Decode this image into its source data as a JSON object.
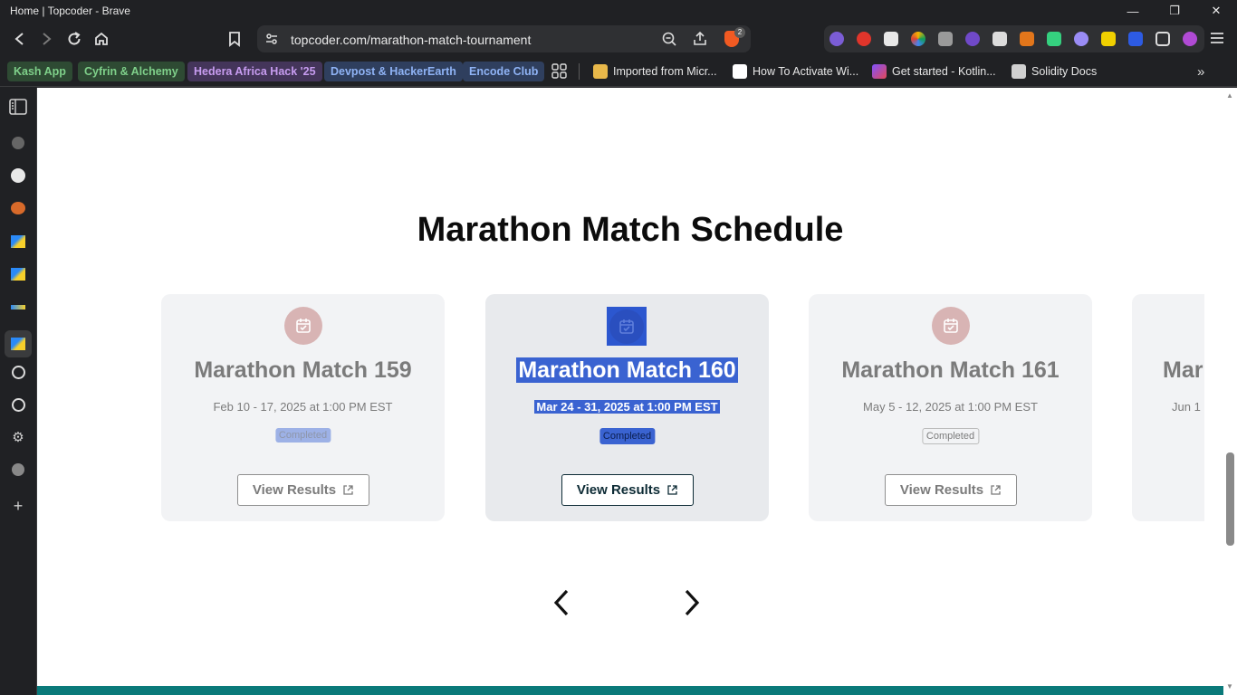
{
  "window": {
    "title": "Home | Topcoder - Brave"
  },
  "address_bar": {
    "url": "topcoder.com/marathon-match-tournament",
    "brave_badge_count": "2"
  },
  "bookmarks": {
    "chips": [
      {
        "label": "Kash App",
        "color": "#7fd08a",
        "bg": "#2e4a33"
      },
      {
        "label": "Cyfrin & Alchemy",
        "color": "#7fd08a",
        "bg": "#2e4a33"
      },
      {
        "label": "Hedera Africa Hack '25",
        "color": "#c79cf0",
        "bg": "#44355a"
      },
      {
        "label": "Devpost & HackerEarth",
        "color": "#8fb3f5",
        "bg": "#2f3f5e"
      },
      {
        "label": "Encode Club",
        "color": "#8fb3f5",
        "bg": "#2f3f5e"
      }
    ],
    "items": [
      {
        "label": "Imported from Micr...",
        "icon": "folder-icon"
      },
      {
        "label": "How To Activate Wi...",
        "icon": "medium-icon"
      },
      {
        "label": "Get started - Kotlin...",
        "icon": "kotlin-icon"
      },
      {
        "label": "Solidity Docs",
        "icon": "solidity-icon"
      }
    ]
  },
  "page": {
    "heading": "Marathon Match Schedule",
    "cards": [
      {
        "title": "Marathon Match 159",
        "date": "Feb 10 - 17, 2025 at 1:00 PM EST",
        "status": "Completed",
        "button": "View Results"
      },
      {
        "title": "Marathon Match 160",
        "date": "Mar 24 - 31, 2025 at 1:00 PM EST",
        "status": "Completed",
        "button": "View Results"
      },
      {
        "title": "Marathon Match 161",
        "date": "May 5 - 12, 2025 at 1:00 PM EST",
        "status": "Completed",
        "button": "View Results"
      },
      {
        "title": "Mar",
        "date": "Jun 1",
        "status": "",
        "button": ""
      }
    ]
  }
}
